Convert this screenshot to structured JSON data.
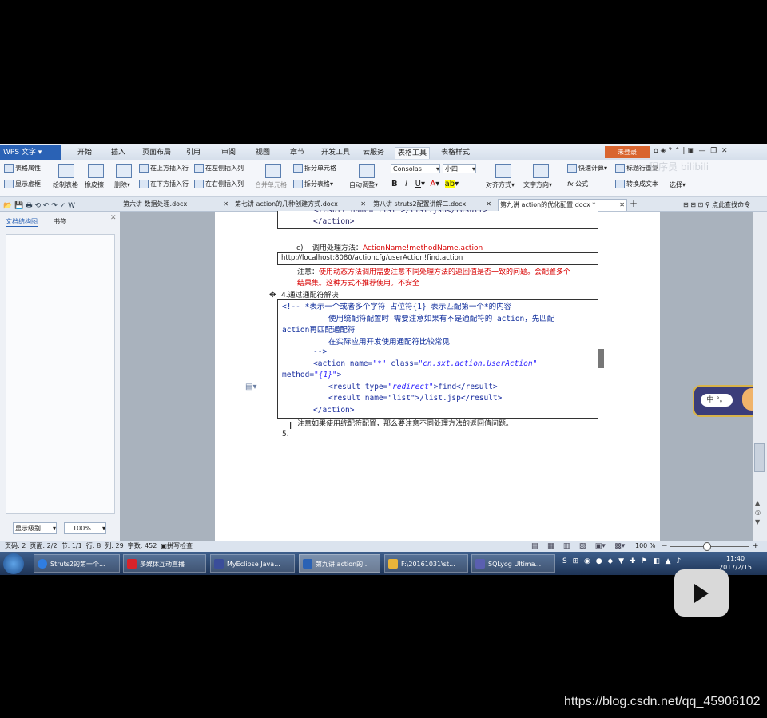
{
  "app": {
    "name": "WPS 文字",
    "login_label": "未登录",
    "watermark_bili": "程序员 bilibili"
  },
  "menu": [
    "开始",
    "插入",
    "页面布局",
    "引用",
    "审阅",
    "视图",
    "章节",
    "开发工具",
    "云服务",
    "表格工具",
    "表格样式"
  ],
  "menu_active": "表格工具",
  "ribbon": {
    "table_props": "表格属性",
    "show_gridlines": "显示虚框",
    "draw_table": "绘制表格",
    "eraser": "橡皮擦",
    "delete": "删除",
    "insert_above": "在上方插入行",
    "insert_below": "在下方插入行",
    "insert_left": "在左侧插入列",
    "insert_right": "在右侧插入列",
    "merge_cells": "合并单元格",
    "split_cells": "拆分单元格",
    "split_table": "拆分表格",
    "autofit": "自动调整",
    "font": "Consolas",
    "size": "小四",
    "align": "对齐方式",
    "text_direction": "文字方向",
    "quick_calc": "快速计算",
    "title_repeat": "标题行重复",
    "formula": "公式",
    "convert_text": "转换成文本",
    "select": "选择"
  },
  "doc_tabs": [
    {
      "label": "第六讲 数据处理.docx",
      "active": false
    },
    {
      "label": "第七讲 action的几种创建方式.docx",
      "active": false
    },
    {
      "label": "第八讲 struts2配置讲解二.docx",
      "active": false
    },
    {
      "label": "第九讲 action的优化配置.docx *",
      "active": true
    }
  ],
  "tabbar_right": "点此查找命令",
  "left_pane": {
    "tab_outline": "文档结构图",
    "tab_bookmark": "书签",
    "level_label": "显示级别",
    "zoom": "100%"
  },
  "document": {
    "top_code_line": "<result name=\"list\">/list.jsp</result>",
    "top_code_close": "</action>",
    "item_c_prefix": "c)",
    "item_c_label": "调用处理方法：",
    "item_c_value": "ActionName!methodName.action",
    "url": "http://localhost:8080/actioncfg/userAction!find.action",
    "note1_prefix": "注意：",
    "note1_line1": "使用动态方法调用需要注意不同处理方法的返回值是否一致的问题。会配置多个",
    "note1_line2": "结果集。这种方式不推荐使用。不安全",
    "heading4": "4.通过通配符解决",
    "code": {
      "l1": "<!-- *表示一个或者多个字符  占位符{1} 表示匹配第一个*的内容",
      "l2": "使用统配符配置时 需要注意如果有不是通配符的 action，先匹配",
      "l3": "action再匹配通配符",
      "l4": "在实际应用开发使用通配符比较常见",
      "l5": "-->",
      "l6_tag": "<action name=",
      "l6_name": "\"*\"",
      "l6_class_attr": " class=",
      "l6_class": "\"cn.sxt.action.UserAction\"",
      "l7_attr": "method=",
      "l7_val": "\"{1}\"",
      "l7_end": ">",
      "l8_tag": "<result type=",
      "l8_val": "\"redirect\"",
      "l8_end": ">find</result>",
      "l9": "<result name=\"list\">/list.jsp</result>",
      "l10": "</action>"
    },
    "note2": "注意如果使用统配符配置，那么要注意不同处理方法的返回值问题。",
    "item5": "5."
  },
  "status": {
    "page": "页码: 2",
    "pages": "页面: 2/2",
    "section": "节: 1/1",
    "row": "行: 8",
    "col": "列: 29",
    "words": "字数: 452",
    "spell": "拼写检查",
    "zoom": "100 %"
  },
  "ime": {
    "label": "中 °。"
  },
  "taskbar": [
    {
      "label": "Struts2的第一个...",
      "color": "#2f7de1"
    },
    {
      "label": "多媒体互动直播",
      "color": "#d8232a"
    },
    {
      "label": "MyEclipse Java...",
      "color": "#3a4d9a"
    },
    {
      "label": "第九讲 action的...",
      "color": "#2a62b5"
    },
    {
      "label": "F:\\20161031\\st...",
      "color": "#e8b43a"
    },
    {
      "label": "SQLyog Ultima...",
      "color": "#5a5fb0"
    }
  ],
  "clock": {
    "time": "11:40",
    "date": "2017/2/15"
  },
  "watermark": "https://blog.csdn.net/qq_45906102"
}
